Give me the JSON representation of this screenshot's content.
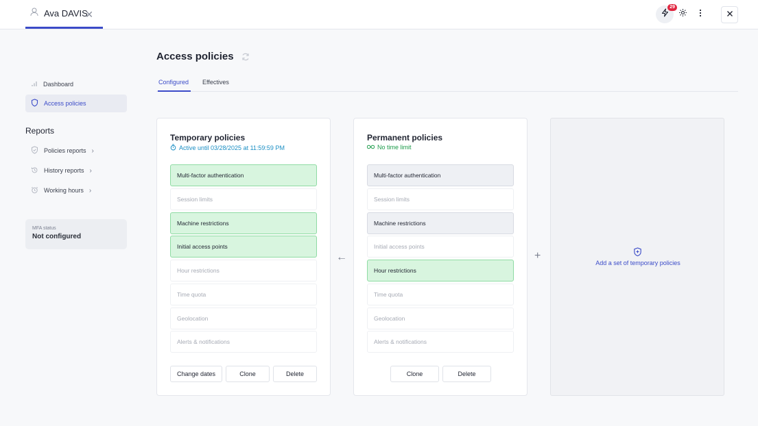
{
  "header": {
    "user_name": "Ava DAVIS",
    "notification_count": "29"
  },
  "sidebar": {
    "items": [
      {
        "label": "Dashboard"
      },
      {
        "label": "Access policies"
      }
    ],
    "reports_heading": "Reports",
    "reports": [
      {
        "label": "Policies reports"
      },
      {
        "label": "History reports"
      },
      {
        "label": "Working hours"
      }
    ],
    "mfa": {
      "label": "MFA status",
      "value": "Not configured"
    }
  },
  "main": {
    "title": "Access policies",
    "tabs": [
      {
        "label": "Configured"
      },
      {
        "label": "Effectives"
      }
    ],
    "temporary": {
      "title": "Temporary policies",
      "subtitle": "Active until 03/28/2025 at 11:59:59 PM",
      "policies": [
        {
          "label": "Multi-factor authentication",
          "enabled": true
        },
        {
          "label": "Session limits",
          "enabled": false
        },
        {
          "label": "Machine restrictions",
          "enabled": true
        },
        {
          "label": "Initial access points",
          "enabled": true
        },
        {
          "label": "Hour restrictions",
          "enabled": false
        },
        {
          "label": "Time quota",
          "enabled": false
        },
        {
          "label": "Geolocation",
          "enabled": false
        },
        {
          "label": "Alerts & notifications",
          "enabled": false
        }
      ],
      "buttons": {
        "change_dates": "Change dates",
        "clone": "Clone",
        "delete": "Delete"
      }
    },
    "permanent": {
      "title": "Permanent policies",
      "subtitle": "No time limit",
      "policies": [
        {
          "label": "Multi-factor authentication",
          "enabled": true
        },
        {
          "label": "Session limits",
          "enabled": false
        },
        {
          "label": "Machine restrictions",
          "enabled": true
        },
        {
          "label": "Initial access points",
          "enabled": false
        },
        {
          "label": "Hour restrictions",
          "enabled": true
        },
        {
          "label": "Time quota",
          "enabled": false
        },
        {
          "label": "Geolocation",
          "enabled": false
        },
        {
          "label": "Alerts & notifications",
          "enabled": false
        }
      ],
      "buttons": {
        "clone": "Clone",
        "delete": "Delete"
      }
    },
    "add_set_label": "Add a set of temporary policies"
  },
  "colors": {
    "accent": "#3b4bc8",
    "active_green": "#d8f5df",
    "active_gray": "#eef0f4",
    "badge": "#e0263f"
  }
}
